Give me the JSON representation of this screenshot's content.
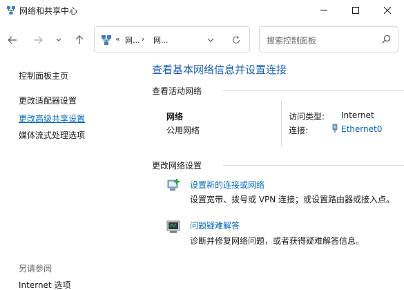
{
  "window": {
    "title": "网络和共享中心",
    "icon": "network-icon"
  },
  "nav": {
    "back": "back-arrow-icon",
    "forward": "forward-arrow-icon",
    "recent": "chevron-down-icon",
    "up": "up-arrow-icon"
  },
  "address": {
    "prefix": "«",
    "crumb1": "网...",
    "sep": "›",
    "crumb2": "网..."
  },
  "search": {
    "placeholder": "搜索控制面板"
  },
  "sidebar": {
    "home": "控制面板主页",
    "items": [
      "更改适配器设置",
      "更改高级共享设置",
      "媒体流式处理选项"
    ],
    "see_also": "另请参阅",
    "see_also_items": [
      "Internet 选项"
    ]
  },
  "main": {
    "title": "查看基本网络信息并设置连接",
    "active_networks_label": "查看活动网络",
    "network": {
      "name": "网络",
      "type": "公用网络",
      "access_type_label": "访问类型:",
      "access_type_value": "Internet",
      "connection_label": "连接:",
      "connection_value": "Ethernet0"
    },
    "change_settings_label": "更改网络设置",
    "tasks": [
      {
        "title": "设置新的连接或网络",
        "description": "设置宽带、拨号或 VPN 连接；或设置路由器或接入点。",
        "icon": "new-connection-icon"
      },
      {
        "title": "问题疑难解答",
        "description": "诊断并修复网络问题，或者获得疑难解答信息。",
        "icon": "troubleshoot-icon"
      }
    ]
  },
  "colors": {
    "accent": "#0067c0",
    "title_blue": "#1a5fb4",
    "muted": "#6b6b6b",
    "border": "#d9d9d9"
  }
}
